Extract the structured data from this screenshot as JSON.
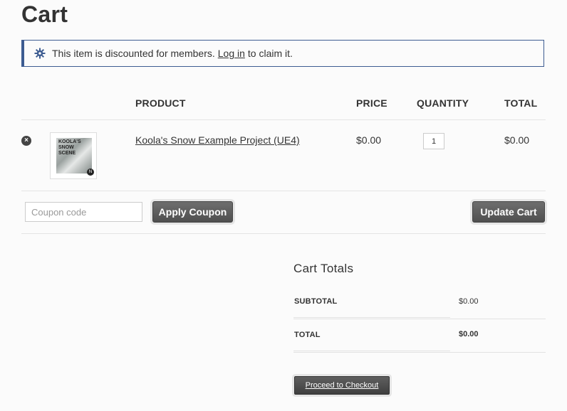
{
  "page": {
    "title": "Cart"
  },
  "notice": {
    "icon": "gear-icon",
    "text_before": "This item is discounted for members.",
    "link_text": "Log in",
    "text_after": "to claim it.",
    "accent_color": "#3d5c91"
  },
  "table": {
    "headers": {
      "product": "PRODUCT",
      "price": "PRICE",
      "quantity": "QUANTITY",
      "total": "TOTAL"
    },
    "rows": [
      {
        "thumbnail_text": "KOOLA'S SNOW SCENE",
        "product_name": "Koola's Snow Example Project (UE4)",
        "price": "$0.00",
        "quantity": "1",
        "total": "$0.00"
      }
    ]
  },
  "actions": {
    "coupon_placeholder": "Coupon code",
    "apply_coupon": "Apply Coupon",
    "update_cart": "Update Cart"
  },
  "totals": {
    "title": "Cart Totals",
    "subtotal_label": "SUBTOTAL",
    "subtotal_value": "$0.00",
    "total_label": "TOTAL",
    "total_value": "$0.00",
    "checkout_label": "Proceed to Checkout"
  }
}
